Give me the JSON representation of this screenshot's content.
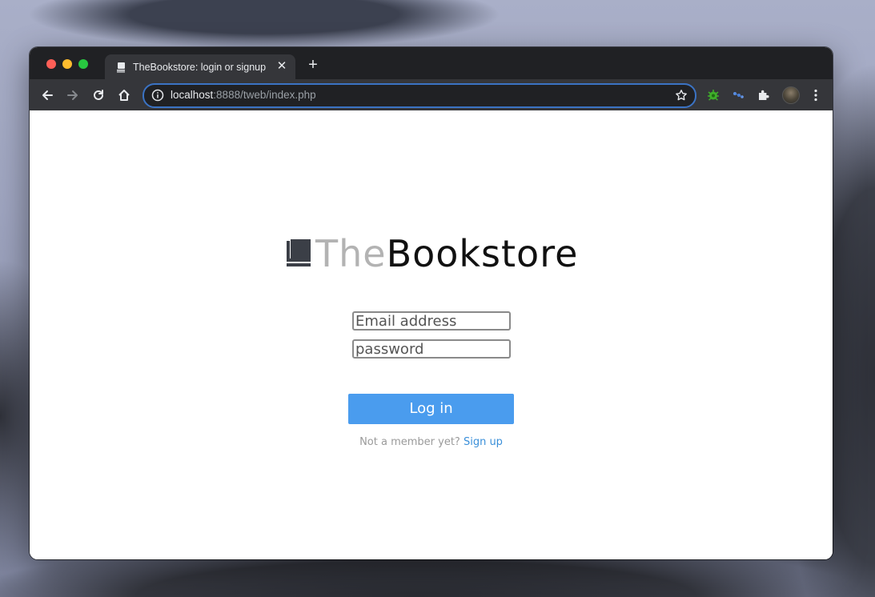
{
  "browser": {
    "tab": {
      "title": "TheBookstore: login or signup"
    },
    "address_bar": {
      "host": "localhost",
      "rest": ":8888/tweb/index.php"
    },
    "accent_color": "#3b73c4"
  },
  "page": {
    "logo": {
      "part1": "The",
      "part2": "Bookstore"
    },
    "email": {
      "placeholder": "Email address"
    },
    "password": {
      "placeholder": "password"
    },
    "login_button": "Log in",
    "signup": {
      "prompt": "Not a member yet?",
      "link": "Sign up"
    },
    "colors": {
      "button": "#4a9cee",
      "link": "#3a8fd9"
    }
  }
}
